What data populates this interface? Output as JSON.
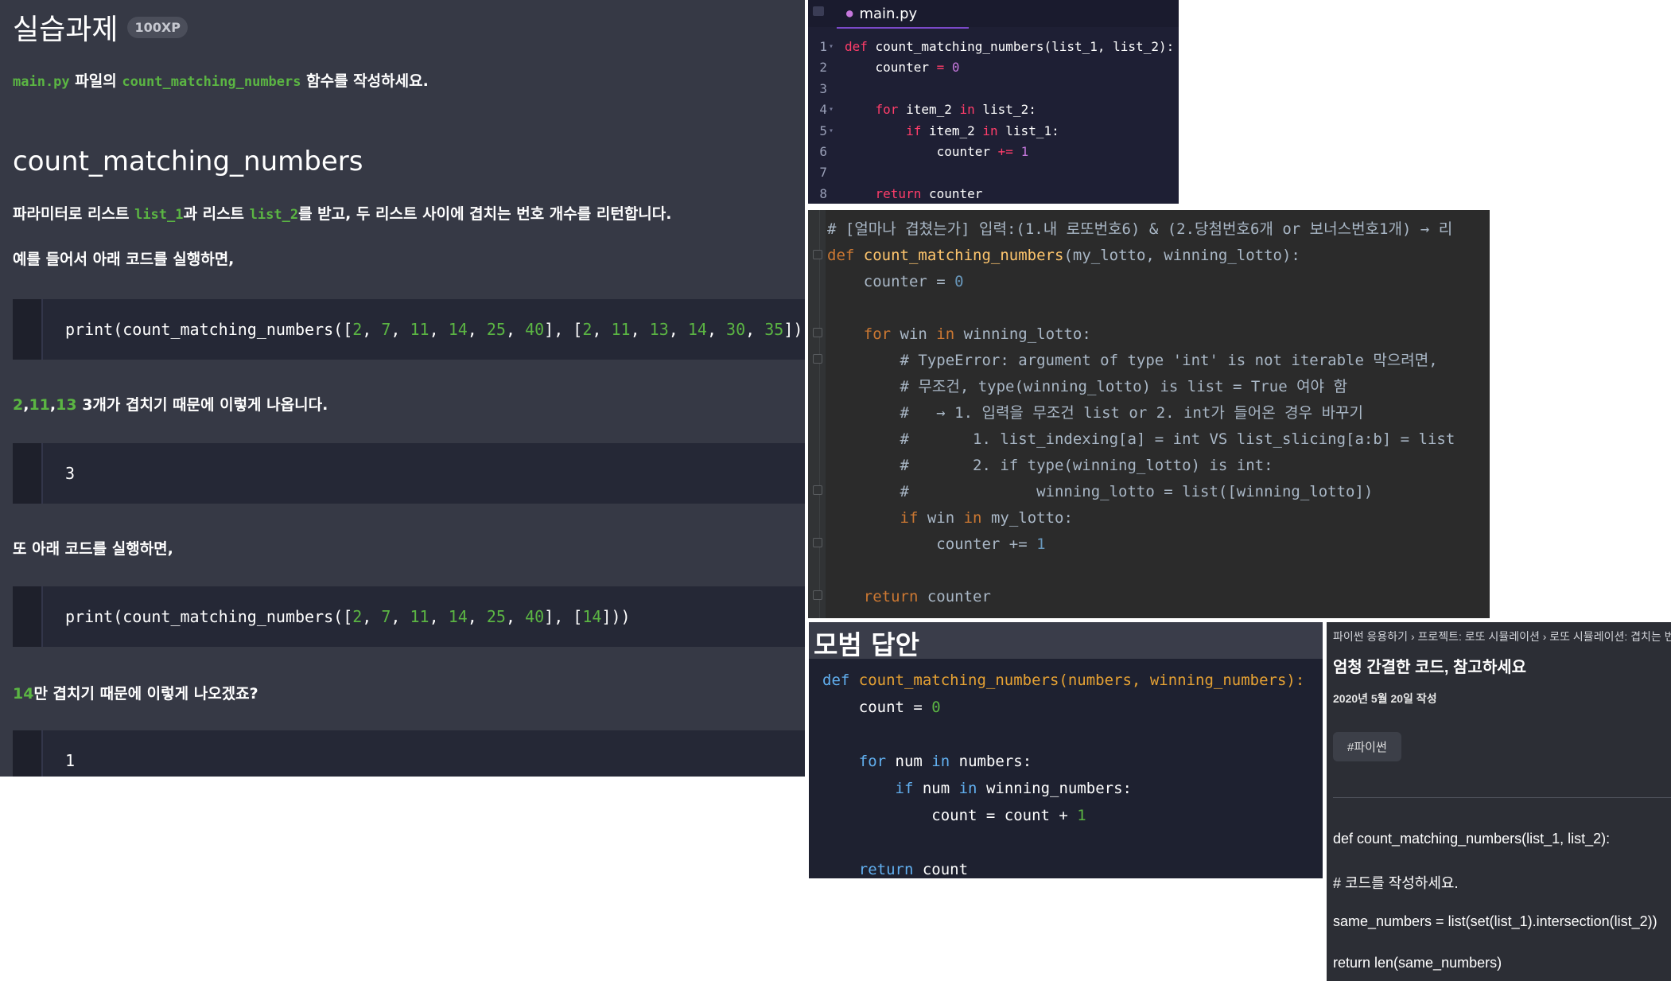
{
  "panel_a": {
    "title": "실습과제",
    "xp_badge": "100XP",
    "instruction": {
      "file": "main.py",
      "text1": " 파일의 ",
      "function": "count_matching_numbers",
      "text2": " 함수를 작성하세요."
    },
    "heading": "count_matching_numbers",
    "para1": {
      "t1": "파라미터로 리스트 ",
      "arg1": "list_1",
      "t2": "과 리스트 ",
      "arg2": "list_2",
      "t3": "를 받고, 두 리스트 사이에 겹치는 번호 개수를 리턴합니다."
    },
    "para2": "예를 들어서 아래 코드를 실행하면,",
    "code1": {
      "prefix": "print(count_matching_numbers([",
      "list1": [
        "2",
        "7",
        "11",
        "14",
        "25",
        "40"
      ],
      "mid": "], [",
      "list2": [
        "2",
        "11",
        "13",
        "14",
        "30",
        "35"
      ],
      "suffix": "]))"
    },
    "result1_nums": [
      "2",
      "11",
      "13"
    ],
    "result1_text": " 3개가 겹치기 때문에 이렇게 나옵니다.",
    "output1": "3",
    "para3": "또 아래 코드를 실행하면,",
    "code2": {
      "prefix": "print(count_matching_numbers([",
      "list1": [
        "2",
        "7",
        "11",
        "14",
        "25",
        "40"
      ],
      "mid": "], [",
      "list2": [
        "14"
      ],
      "suffix": "]))"
    },
    "result2_num": "14",
    "result2_text": "만 겹치기 때문에 이렇게 나오겠죠?",
    "output2": "1"
  },
  "panel_b": {
    "tab_name": "main.py",
    "line_numbers": [
      "1",
      "2",
      "3",
      "4",
      "5",
      "6",
      "7",
      "8"
    ],
    "l1_kw": "def",
    "l1_rest": " count_matching_numbers(list_1, list_2):",
    "l2_a": "    counter ",
    "l2_op": "=",
    "l2_num": "0",
    "l4_kw": "for",
    "l4_mid": " item_2 ",
    "l4_in": "in",
    "l4_rest": " list_2:",
    "l5_kw": "if",
    "l5_mid": " item_2 ",
    "l5_in": "in",
    "l5_rest": " list_1:",
    "l6_a": "counter ",
    "l6_op": "+=",
    "l6_num": "1",
    "l8_kw": "return",
    "l8_rest": " counter"
  },
  "panel_c": {
    "comment_top": "# [얼마나 겹쳤는가] 입력:(1.내 로또번호6) & (2.당첨번호6개 or 보너스번호1개) → 리",
    "def_kw": "def",
    "fn_name": "count_matching_numbers",
    "params": "(my_lotto, winning_lotto):",
    "counter_line": "    counter = ",
    "counter_num": "0",
    "for_kw": "for",
    "for_rest": " win ",
    "for_in": "in",
    "for_tail": " winning_lotto:",
    "comments": [
      "# TypeError: argument of type 'int' is not iterable 막으려면,",
      "# 무조건, type(winning_lotto) is list = True 여야 함",
      "#   → 1. 입력을 무조건 list or 2. int가 들어온 경우 바꾸기",
      "#       1. list_indexing[a] = int VS list_slicing[a:b] = list",
      "#       2. if type(winning_lotto) is int:",
      "#              winning_lotto = list([winning_lotto])"
    ],
    "if_kw": "if",
    "if_rest": " win ",
    "if_in": "in",
    "if_tail": " my_lotto:",
    "inc_line": "counter += ",
    "inc_num": "1",
    "return_kw": "return",
    "return_rest": " counter"
  },
  "panel_d": {
    "title": "모범 답안",
    "def_kw": "def",
    "signature": " count_matching_numbers(numbers, winning_numbers):",
    "count_init": "    count = ",
    "count_num": "0",
    "for_kw": "for",
    "for_rest": " num ",
    "for_in": "in",
    "for_tail": " numbers:",
    "if_kw": "if",
    "if_rest": " num ",
    "if_in": "in",
    "if_tail": " winning_numbers:",
    "inc_line": "            count = count + ",
    "inc_num": "1",
    "return_kw": "return",
    "return_rest": " count"
  },
  "panel_e": {
    "breadcrumb": "파이썬 응용하기 › 프로젝트: 로또 시뮬레이션 › 로또 시뮬레이션: 겹치는 번",
    "title": "엄청 간결한 코드, 참고하세요",
    "date": "2020년 5월 20일 작성",
    "tag": "#파이썬",
    "code_lines": [
      "def count_matching_numbers(list_1, list_2):",
      " # 코드를 작성하세요.",
      " same_numbers = list(set(list_1).intersection(list_2))",
      " return len(same_numbers)"
    ]
  }
}
